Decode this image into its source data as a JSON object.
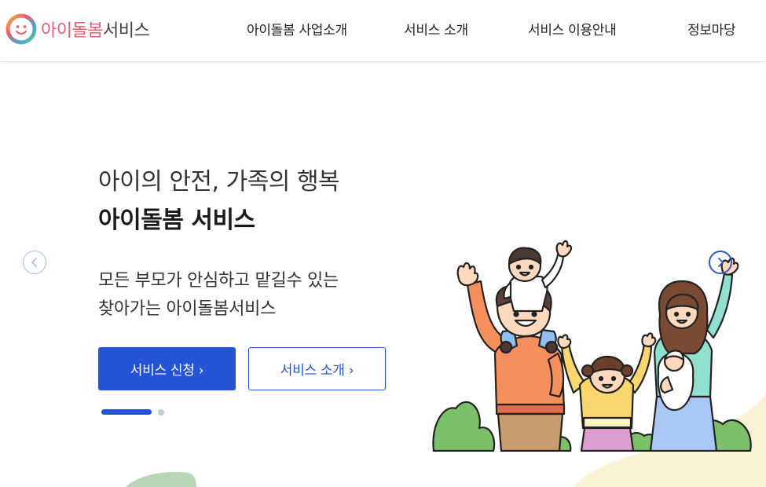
{
  "header": {
    "logo": {
      "text_a": "아이돌봄",
      "text_b": "서비스"
    },
    "nav": [
      "아이돌봄 사업소개",
      "서비스 소개",
      "서비스 이용안내",
      "정보마당"
    ]
  },
  "hero": {
    "subtitle": "아이의 안전, 가족의 행복",
    "title": "아이돌봄 서비스",
    "desc_line1": "모든 부모가 안심하고 맡길수 있는",
    "desc_line2": "찾아가는 아이돌봄서비스",
    "btn_apply": "서비스 신청 ›",
    "btn_intro": "서비스 소개 ›"
  },
  "carousel": {
    "slide_count": 2,
    "active_slide": 1
  },
  "colors": {
    "brand_blue": "#2453d6",
    "logo_pink": "#ee5a6f"
  },
  "icons": {
    "prev": "chevron-left-icon",
    "next": "chevron-right-icon",
    "logo": "smiley-logo-icon"
  }
}
